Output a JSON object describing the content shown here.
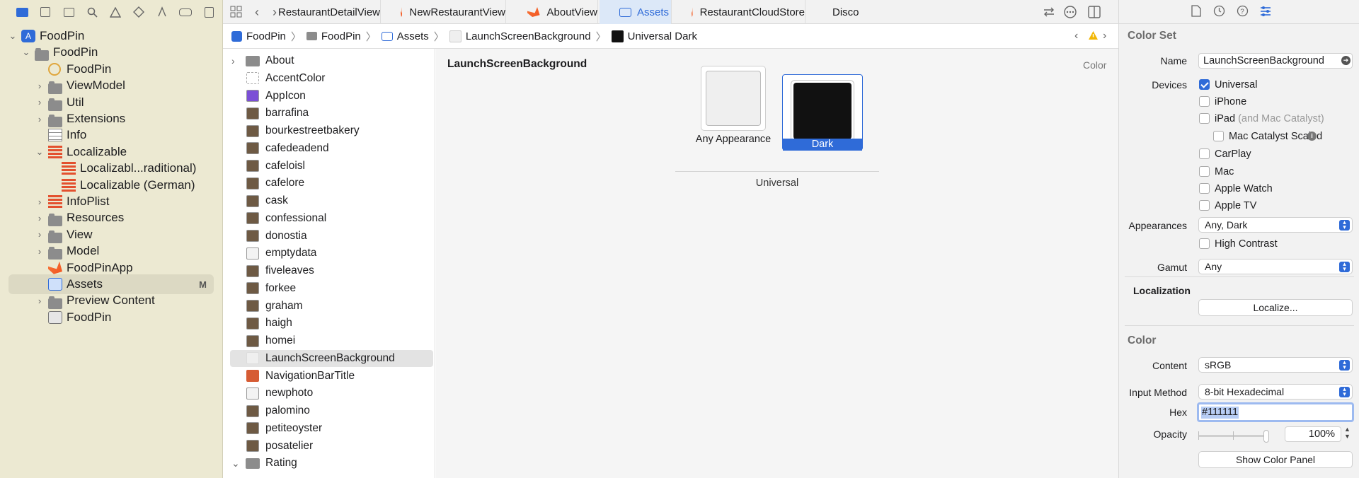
{
  "navigator": {
    "items": [
      {
        "label": "FoodPin",
        "icon": "project-icon",
        "level": 0,
        "disclosure": "open"
      },
      {
        "label": "FoodPin",
        "icon": "folder-icon",
        "level": 1,
        "disclosure": "open"
      },
      {
        "label": "FoodPin",
        "icon": "entitlements-icon",
        "level": 2,
        "disclosure": ""
      },
      {
        "label": "ViewModel",
        "icon": "folder-icon",
        "level": 2,
        "disclosure": "closed"
      },
      {
        "label": "Util",
        "icon": "folder-icon",
        "level": 2,
        "disclosure": "closed"
      },
      {
        "label": "Extensions",
        "icon": "folder-icon",
        "level": 2,
        "disclosure": "closed"
      },
      {
        "label": "Info",
        "icon": "plist-icon",
        "level": 2,
        "disclosure": ""
      },
      {
        "label": "Localizable",
        "icon": "strings-icon",
        "level": 2,
        "disclosure": "open"
      },
      {
        "label": "Localizabl...raditional)",
        "icon": "strings-icon",
        "level": 3,
        "disclosure": ""
      },
      {
        "label": "Localizable (German)",
        "icon": "strings-icon",
        "level": 3,
        "disclosure": ""
      },
      {
        "label": "InfoPlist",
        "icon": "strings-icon",
        "level": 2,
        "disclosure": "closed"
      },
      {
        "label": "Resources",
        "icon": "folder-icon",
        "level": 2,
        "disclosure": "closed"
      },
      {
        "label": "View",
        "icon": "folder-icon",
        "level": 2,
        "disclosure": "closed"
      },
      {
        "label": "Model",
        "icon": "folder-icon",
        "level": 2,
        "disclosure": "closed"
      },
      {
        "label": "FoodPinApp",
        "icon": "swift-icon",
        "level": 2,
        "disclosure": ""
      },
      {
        "label": "Assets",
        "icon": "assets-icon",
        "level": 2,
        "disclosure": "",
        "badge": "M",
        "selected": true
      },
      {
        "label": "Preview Content",
        "icon": "folder-icon",
        "level": 2,
        "disclosure": "closed"
      },
      {
        "label": "FoodPin",
        "icon": "testplan-icon",
        "level": 2,
        "disclosure": ""
      }
    ]
  },
  "tabs": [
    {
      "label": "RestaurantDetailView",
      "icon": "swift-icon"
    },
    {
      "label": "NewRestaurantView",
      "icon": "swift-icon"
    },
    {
      "label": "AboutView",
      "icon": "swift-icon"
    },
    {
      "label": "Assets",
      "icon": "assets-icon",
      "active": true
    },
    {
      "label": "RestaurantCloudStore",
      "icon": "swift-icon"
    },
    {
      "label": "Discov",
      "icon": "swift-icon"
    }
  ],
  "breadcrumb": [
    "FoodPin",
    "FoodPin",
    "Assets",
    "LaunchScreenBackground",
    "Universal Dark"
  ],
  "asset_list": [
    {
      "label": "About",
      "kind": "folder"
    },
    {
      "label": "AccentColor",
      "kind": "color-empty"
    },
    {
      "label": "AppIcon",
      "kind": "appicon"
    },
    {
      "label": "barrafina",
      "kind": "image"
    },
    {
      "label": "bourkestreetbakery",
      "kind": "image"
    },
    {
      "label": "cafedeadend",
      "kind": "image"
    },
    {
      "label": "cafeloisl",
      "kind": "image"
    },
    {
      "label": "cafelore",
      "kind": "image"
    },
    {
      "label": "cask",
      "kind": "image"
    },
    {
      "label": "confessional",
      "kind": "image"
    },
    {
      "label": "donostia",
      "kind": "image"
    },
    {
      "label": "emptydata",
      "kind": "image"
    },
    {
      "label": "fiveleaves",
      "kind": "image"
    },
    {
      "label": "forkee",
      "kind": "image"
    },
    {
      "label": "graham",
      "kind": "image"
    },
    {
      "label": "haigh",
      "kind": "image"
    },
    {
      "label": "homei",
      "kind": "image"
    },
    {
      "label": "LaunchScreenBackground",
      "kind": "color-light",
      "selected": true
    },
    {
      "label": "NavigationBarTitle",
      "kind": "color-orange"
    },
    {
      "label": "newphoto",
      "kind": "image"
    },
    {
      "label": "palomino",
      "kind": "image"
    },
    {
      "label": "petiteoyster",
      "kind": "image"
    },
    {
      "label": "posatelier",
      "kind": "image"
    },
    {
      "label": "Rating",
      "kind": "folder"
    }
  ],
  "editor": {
    "title": "LaunchScreenBackground",
    "type_label": "Color",
    "any_label": "Any Appearance",
    "dark_label": "Dark",
    "group_label": "Universal",
    "any_color": "#efefef",
    "dark_color": "#111111"
  },
  "inspector": {
    "color_set_header": "Color Set",
    "name_label": "Name",
    "name_value": "LaunchScreenBackground",
    "devices_label": "Devices",
    "devices": [
      {
        "label": "Universal",
        "checked": true
      },
      {
        "label": "iPhone",
        "checked": false
      },
      {
        "label": "iPad",
        "checked": false,
        "suffix": "(and Mac Catalyst)"
      },
      {
        "label": "Mac Catalyst Scaled",
        "checked": false
      },
      {
        "label": "CarPlay",
        "checked": false
      },
      {
        "label": "Mac",
        "checked": false
      },
      {
        "label": "Apple Watch",
        "checked": false
      },
      {
        "label": "Apple TV",
        "checked": false
      }
    ],
    "appearances_label": "Appearances",
    "appearances_value": "Any, Dark",
    "high_contrast": "High Contrast",
    "gamut_label": "Gamut",
    "gamut_value": "Any",
    "localization_header": "Localization",
    "localize_button": "Localize...",
    "color_header": "Color",
    "content_label": "Content",
    "content_value": "sRGB",
    "input_method_label": "Input Method",
    "input_method_value": "8-bit Hexadecimal",
    "hex_label": "Hex",
    "hex_value": "#111111",
    "opacity_label": "Opacity",
    "opacity_value": "100%",
    "opacity_fraction": 1.0,
    "show_color_panel": "Show Color Panel"
  }
}
